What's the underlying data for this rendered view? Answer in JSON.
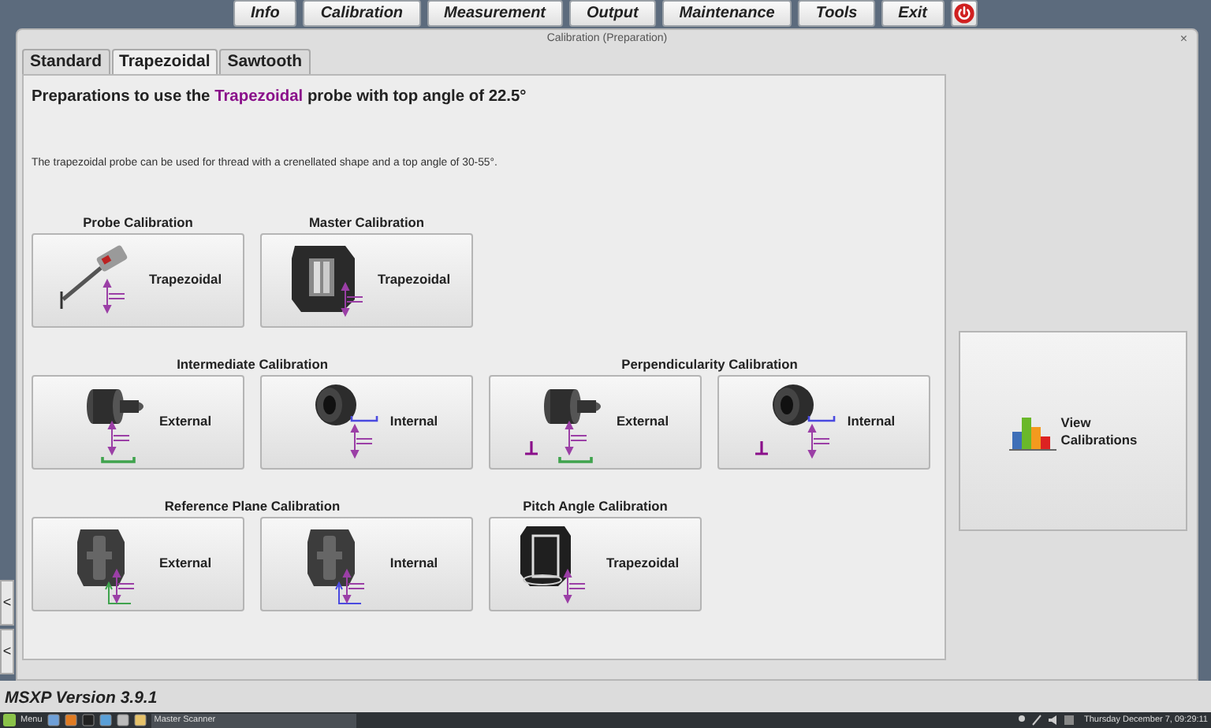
{
  "menu": [
    {
      "label": "Info"
    },
    {
      "label": "Calibration"
    },
    {
      "label": "Measurement"
    },
    {
      "label": "Output"
    },
    {
      "label": "Maintenance"
    },
    {
      "label": "Tools"
    },
    {
      "label": "Exit"
    }
  ],
  "window": {
    "title": "Calibration (Preparation)",
    "close": "×"
  },
  "tabs": [
    {
      "label": "Standard",
      "selected": false
    },
    {
      "label": "Trapezoidal",
      "selected": true
    },
    {
      "label": "Sawtooth",
      "selected": false
    }
  ],
  "heading": [
    {
      "text": "Preparations to use the ",
      "highlight": false
    },
    {
      "text": "Trapezoidal",
      "highlight": true
    },
    {
      "text": " probe with top angle of 22.5°",
      "highlight": false
    }
  ],
  "description": "The trapezoidal probe can be used for thread with a crenellated shape and a top angle of 30-55°.",
  "sections": [
    {
      "title": "Probe Calibration",
      "buttons": [
        {
          "label": "Trapezoidal",
          "kind": "probe"
        }
      ]
    },
    {
      "title": "Master Calibration",
      "buttons": [
        {
          "label": "Trapezoidal",
          "kind": "master"
        }
      ]
    },
    {
      "title": "Intermediate Calibration",
      "buttons": [
        {
          "label": "External",
          "kind": "plug"
        },
        {
          "label": "Internal",
          "kind": "ring"
        }
      ]
    },
    {
      "title": "Perpendicularity Calibration",
      "buttons": [
        {
          "label": "External",
          "kind": "perpplug"
        },
        {
          "label": "Internal",
          "kind": "perpring"
        }
      ]
    },
    {
      "title": "Reference Plane Calibration",
      "buttons": [
        {
          "label": "External",
          "kind": "blockext"
        },
        {
          "label": "Internal",
          "kind": "blockint"
        }
      ]
    },
    {
      "title": "Pitch Angle Calibration",
      "buttons": [
        {
          "label": "Trapezoidal",
          "kind": "pitch"
        }
      ]
    }
  ],
  "view_button": {
    "line_1": "View",
    "line_2": "Calibrations"
  },
  "side_buttons": [
    "<",
    "<"
  ],
  "version": "MSXP Version 3.9.1",
  "taskbar": {
    "menu": "Menu",
    "task": "Master Scanner",
    "clock": "Thursday December 7, 09:29:11"
  }
}
